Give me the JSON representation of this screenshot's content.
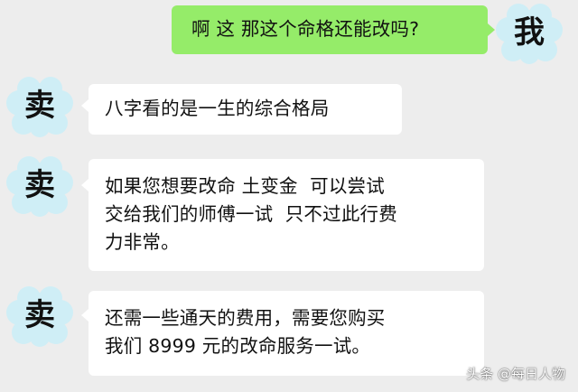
{
  "colors": {
    "background": "#ededed",
    "sent_bubble": "#95ec69",
    "received_bubble": "#ffffff",
    "avatar_cloud": "#cfeef6"
  },
  "me_avatar": {
    "label": "我",
    "icon": "cloud-avatar-icon"
  },
  "seller_avatar": {
    "label": "卖",
    "icon": "cloud-avatar-icon"
  },
  "messages": [
    {
      "sender": "me",
      "text": "啊 这 那这个命格还能改吗?"
    },
    {
      "sender": "seller",
      "text": "八字看的是一生的综合格局"
    },
    {
      "sender": "seller",
      "text": "如果您想要改命 土变金  可以尝试\n交给我们的师傅一试  只不过此行费\n力非常。"
    },
    {
      "sender": "seller",
      "text": "还需一些通天的费用，需要您购买\n我们 8999 元的改命服务一试。"
    }
  ],
  "watermark": "头条 @每日人物"
}
